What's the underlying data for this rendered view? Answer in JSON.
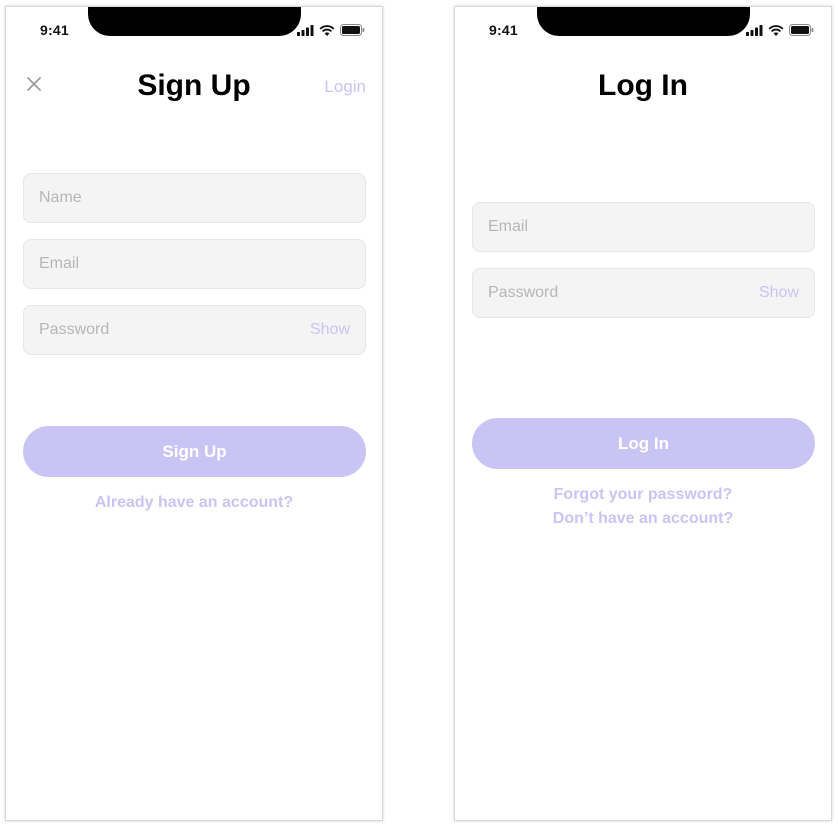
{
  "colors": {
    "accent": "#c9c4f3",
    "field_background": "#f4f4f4",
    "placeholder": "#b6b6b6",
    "title": "#000000"
  },
  "status_bar": {
    "time": "9:41",
    "icons": [
      "signal-icon",
      "wifi-icon",
      "battery-icon"
    ]
  },
  "signup_screen": {
    "title": "Sign Up",
    "close_icon": "close-icon",
    "login_link": "Login",
    "name_placeholder": "Name",
    "email_placeholder": "Email",
    "password_placeholder": "Password",
    "show_label": "Show",
    "submit_label": "Sign Up",
    "account_link": "Already have an account?"
  },
  "login_screen": {
    "title": "Log In",
    "email_placeholder": "Email",
    "password_placeholder": "Password",
    "show_label": "Show",
    "submit_label": "Log In",
    "forgot_link": "Forgot your password?",
    "signup_link": "Don’t have an account?"
  }
}
